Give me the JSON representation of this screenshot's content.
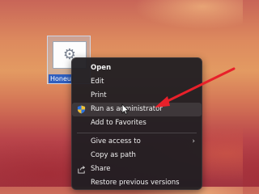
{
  "desktop": {
    "file_icon": {
      "icon": "gear-icon",
      "label": "Honeu"
    }
  },
  "context_menu": {
    "items": [
      {
        "label": "Open",
        "bold": true
      },
      {
        "label": "Edit"
      },
      {
        "label": "Print"
      },
      {
        "label": "Run as administrator",
        "icon": "shield-icon",
        "hovered": true
      },
      {
        "label": "Add to Favorites"
      },
      {
        "label": "Give access to",
        "has_submenu": true
      },
      {
        "label": "Copy as path"
      },
      {
        "label": "Share",
        "icon": "share-icon"
      },
      {
        "label": "Restore previous versions"
      }
    ]
  },
  "annotation": {
    "arrow_color": "#e8202a"
  }
}
